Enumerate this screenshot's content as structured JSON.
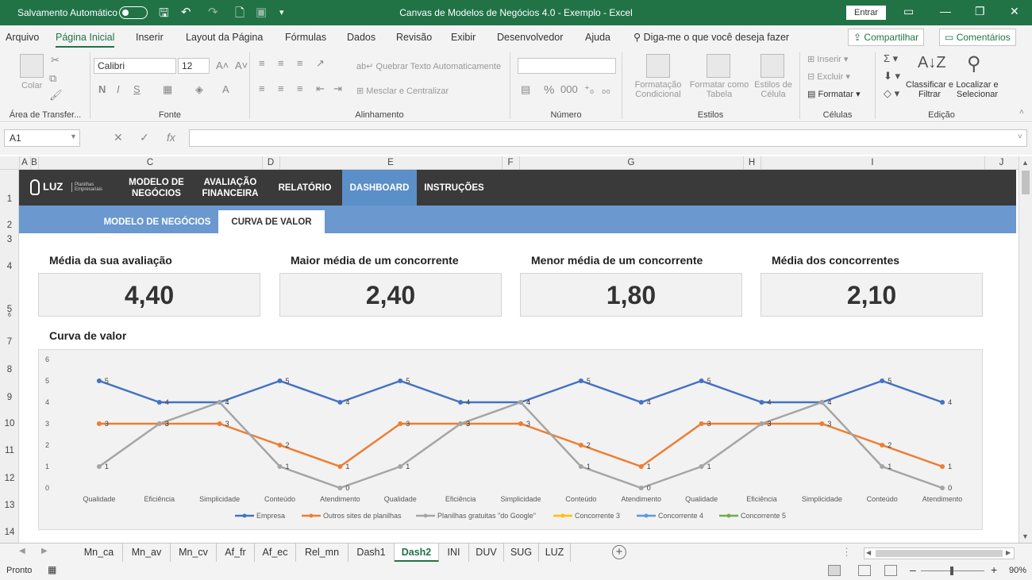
{
  "titlebar": {
    "autosave_label": "Salvamento Automático",
    "title": "Canvas de Modelos de Negócios 4.0 - Exemplo  -  Excel",
    "signin": "Entrar"
  },
  "ribbon_tabs": [
    "Arquivo",
    "Página Inicial",
    "Inserir",
    "Layout da Página",
    "Fórmulas",
    "Dados",
    "Revisão",
    "Exibir",
    "Desenvolvedor",
    "Ajuda"
  ],
  "tell_me": "Diga-me o que você deseja fazer",
  "share_label": "Compartilhar",
  "comments_label": "Comentários",
  "ribbon": {
    "paste": "Colar",
    "font_name": "Calibri",
    "font_size": "12",
    "wrap_text": "Quebrar Texto Automaticamente",
    "merge_center": "Mesclar e Centralizar",
    "cond_format": "Formatação Condicional",
    "format_table": "Formatar como Tabela",
    "cell_styles": "Estilos de Célula",
    "insert": "Inserir",
    "delete": "Excluir",
    "format": "Formatar",
    "sort_filter": "Classificar e Filtrar",
    "find_select": "Localizar e Selecionar",
    "groups": [
      "Área de Transfer...",
      "Fonte",
      "Alinhamento",
      "Número",
      "Estilos",
      "Células",
      "Edição"
    ]
  },
  "namebox": "A1",
  "columns": [
    "A",
    "B",
    "C",
    "D",
    "E",
    "F",
    "G",
    "H",
    "I",
    "J"
  ],
  "rows": [
    "1",
    "2",
    "3",
    "4",
    "5",
    "6",
    "7",
    "8",
    "9",
    "10",
    "11",
    "12",
    "13",
    "14"
  ],
  "nav": {
    "logo": "LUZ",
    "logo_sub": "Planilhas Empresariais",
    "items": [
      "MODELO DE NEGÓCIOS",
      "AVALIAÇÃO FINANCEIRA",
      "RELATÓRIO",
      "DASHBOARD",
      "INSTRUÇÕES"
    ],
    "subitems": [
      "MODELO DE NEGÓCIOS",
      "CURVA DE VALOR"
    ]
  },
  "kpis": [
    {
      "title": "Média da sua avaliação",
      "value": "4,40"
    },
    {
      "title": "Maior média de um concorrente",
      "value": "2,40"
    },
    {
      "title": "Menor média de um concorrente",
      "value": "1,80"
    },
    {
      "title": "Média dos concorrentes",
      "value": "2,10"
    }
  ],
  "chart_data": {
    "type": "line",
    "title": "Curva de valor",
    "categories": [
      "Qualidade",
      "Eficiência",
      "Simplicidade",
      "Conteúdo",
      "Atendimento",
      "Qualidade",
      "Eficiência",
      "Simplicidade",
      "Conteúdo",
      "Atendimento",
      "Qualidade",
      "Eficiência",
      "Simplicidade",
      "Conteúdo",
      "Atendimento"
    ],
    "ylim": [
      0,
      6
    ],
    "yticks": [
      "0",
      "1",
      "2",
      "3",
      "4",
      "5",
      "6"
    ],
    "legend_position": "bottom",
    "series": [
      {
        "name": "Empresa",
        "color": "#4472c4",
        "values": [
          5,
          4,
          4,
          5,
          4,
          5,
          4,
          4,
          5,
          4,
          5,
          4,
          4,
          5,
          4
        ]
      },
      {
        "name": "Outros sites de planilhas",
        "color": "#ed7d31",
        "values": [
          3,
          3,
          3,
          2,
          1,
          3,
          3,
          3,
          2,
          1,
          3,
          3,
          3,
          2,
          1
        ]
      },
      {
        "name": "Planilhas gratuitas \"do Google\"",
        "color": "#a5a5a5",
        "values": [
          1,
          3,
          4,
          1,
          0,
          1,
          3,
          4,
          1,
          0,
          1,
          3,
          4,
          1,
          0
        ]
      },
      {
        "name": "Concorrente 3",
        "color": "#ffc000",
        "values": []
      },
      {
        "name": "Concorrente 4",
        "color": "#5b9bd5",
        "values": []
      },
      {
        "name": "Concorrente 5",
        "color": "#70ad47",
        "values": []
      }
    ]
  },
  "sheet_tabs": [
    "Mn_ca",
    "Mn_av",
    "Mn_cv",
    "Af_fr",
    "Af_ec",
    "Rel_mn",
    "Dash1",
    "Dash2",
    "INI",
    "DUV",
    "SUG",
    "LUZ"
  ],
  "active_sheet": "Dash2",
  "status": {
    "ready": "Pronto",
    "zoom": "90%"
  }
}
